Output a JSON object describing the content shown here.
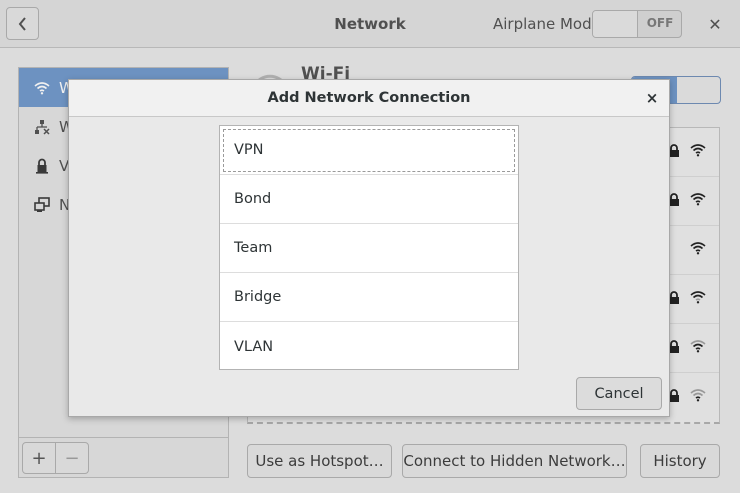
{
  "header": {
    "title": "Network",
    "airplane_label": "Airplane Mode",
    "airplane_state": "OFF"
  },
  "sidebar": {
    "items": [
      {
        "label": "W",
        "icon": "wifi-icon"
      },
      {
        "label": "W",
        "icon": "wired-icon"
      },
      {
        "label": "VI",
        "icon": "vpn-icon"
      },
      {
        "label": "N",
        "icon": "network-proxy-icon"
      }
    ],
    "add_label": "+",
    "remove_label": "−"
  },
  "main": {
    "heading": "Wi-Fi"
  },
  "buttons": {
    "hotspot": "Use as Hotspot…",
    "hidden": "Connect to Hidden Network…",
    "history": "History"
  },
  "dialog": {
    "title": "Add Network Connection",
    "close": "×",
    "types": [
      "VPN",
      "Bond",
      "Team",
      "Bridge",
      "VLAN"
    ],
    "cancel": "Cancel"
  },
  "colors": {
    "accent": "#6d92c1",
    "background": "#dcdcdc",
    "dialog_bg": "#e9e9e9"
  }
}
